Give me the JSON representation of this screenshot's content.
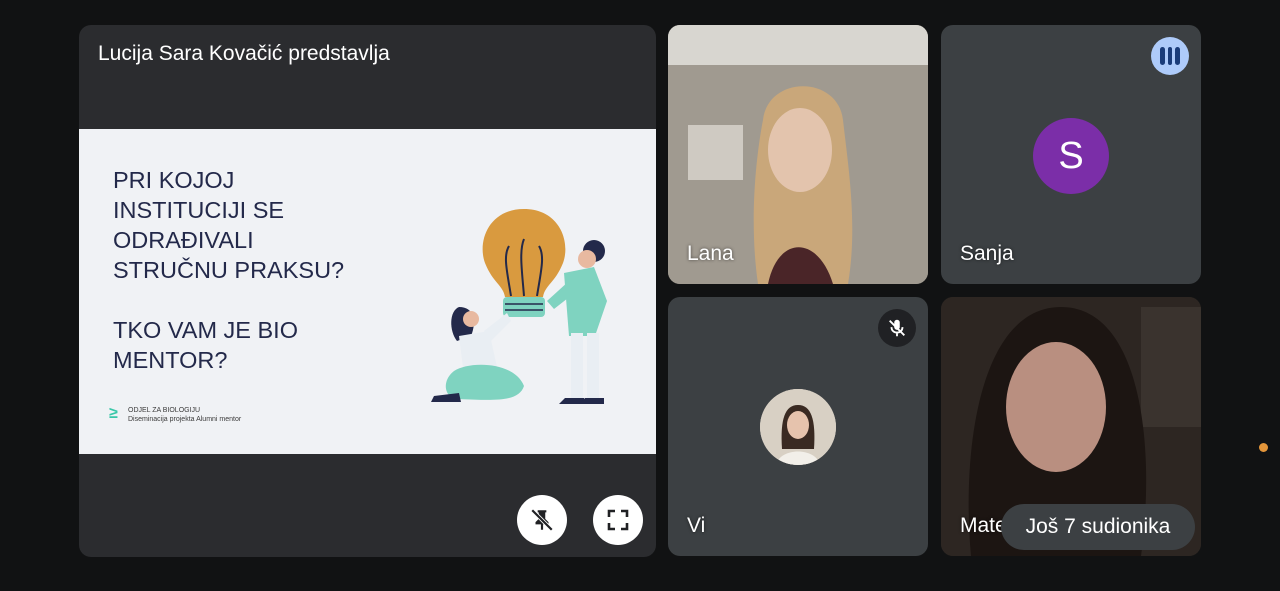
{
  "presenter": {
    "title": "Lucija Sara Kovačić predstavlja",
    "slide": {
      "question": "PRI KOJOJ\nINSTITUCIJI SE\nODRAĐIVALI\nSTRUČNU PRAKSU?\n\nTKO VAM JE BIO\nMENTOR?",
      "logo_mark": "≥",
      "logo_line1": "ODJEL ZA BIOLOGIJU",
      "logo_line2": "Diseminacija projekta Alumni mentor"
    },
    "controls": {
      "unpin_icon": "unpin-icon",
      "fullscreen_icon": "fullscreen-icon"
    }
  },
  "participants": [
    {
      "name": "Lana"
    },
    {
      "name": "Sanja",
      "avatar_letter": "S",
      "avatar_color": "#7b2ea8",
      "status_icon": "speaking-indicator-icon"
    },
    {
      "name": "Vi",
      "status_icon": "mic-off-icon"
    },
    {
      "name": "Mate"
    }
  ],
  "more_participants": "Još 7 sudionika",
  "colors": {
    "background": "#111213",
    "tile": "#3c4043",
    "accent_dot": "#e3953a"
  }
}
